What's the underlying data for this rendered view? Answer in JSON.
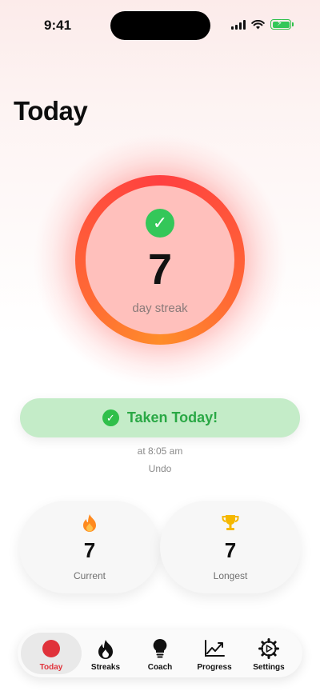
{
  "status_bar": {
    "time": "9:41"
  },
  "screen": {
    "title": "Today"
  },
  "streak": {
    "count": "7",
    "label": "day streak"
  },
  "taken": {
    "label": "Taken Today!",
    "time_text": "at 8:05 am",
    "undo_label": "Undo"
  },
  "stats": [
    {
      "value": "7",
      "label": "Current",
      "icon": "flame-icon"
    },
    {
      "value": "7",
      "label": "Longest",
      "icon": "trophy-icon"
    }
  ],
  "tabs": [
    {
      "label": "Today",
      "icon": "red-dot-icon",
      "active": true
    },
    {
      "label": "Streaks",
      "icon": "flame-icon",
      "active": false
    },
    {
      "label": "Coach",
      "icon": "lightbulb-icon",
      "active": false
    },
    {
      "label": "Progress",
      "icon": "chart-icon",
      "active": false
    },
    {
      "label": "Settings",
      "icon": "gear-icon",
      "active": false
    }
  ],
  "colors": {
    "accent_red": "#e0323a",
    "ring_start": "#ff4040",
    "ring_end": "#ff8c2a",
    "success_green": "#34c759",
    "taken_bg": "#c4ecc8"
  }
}
